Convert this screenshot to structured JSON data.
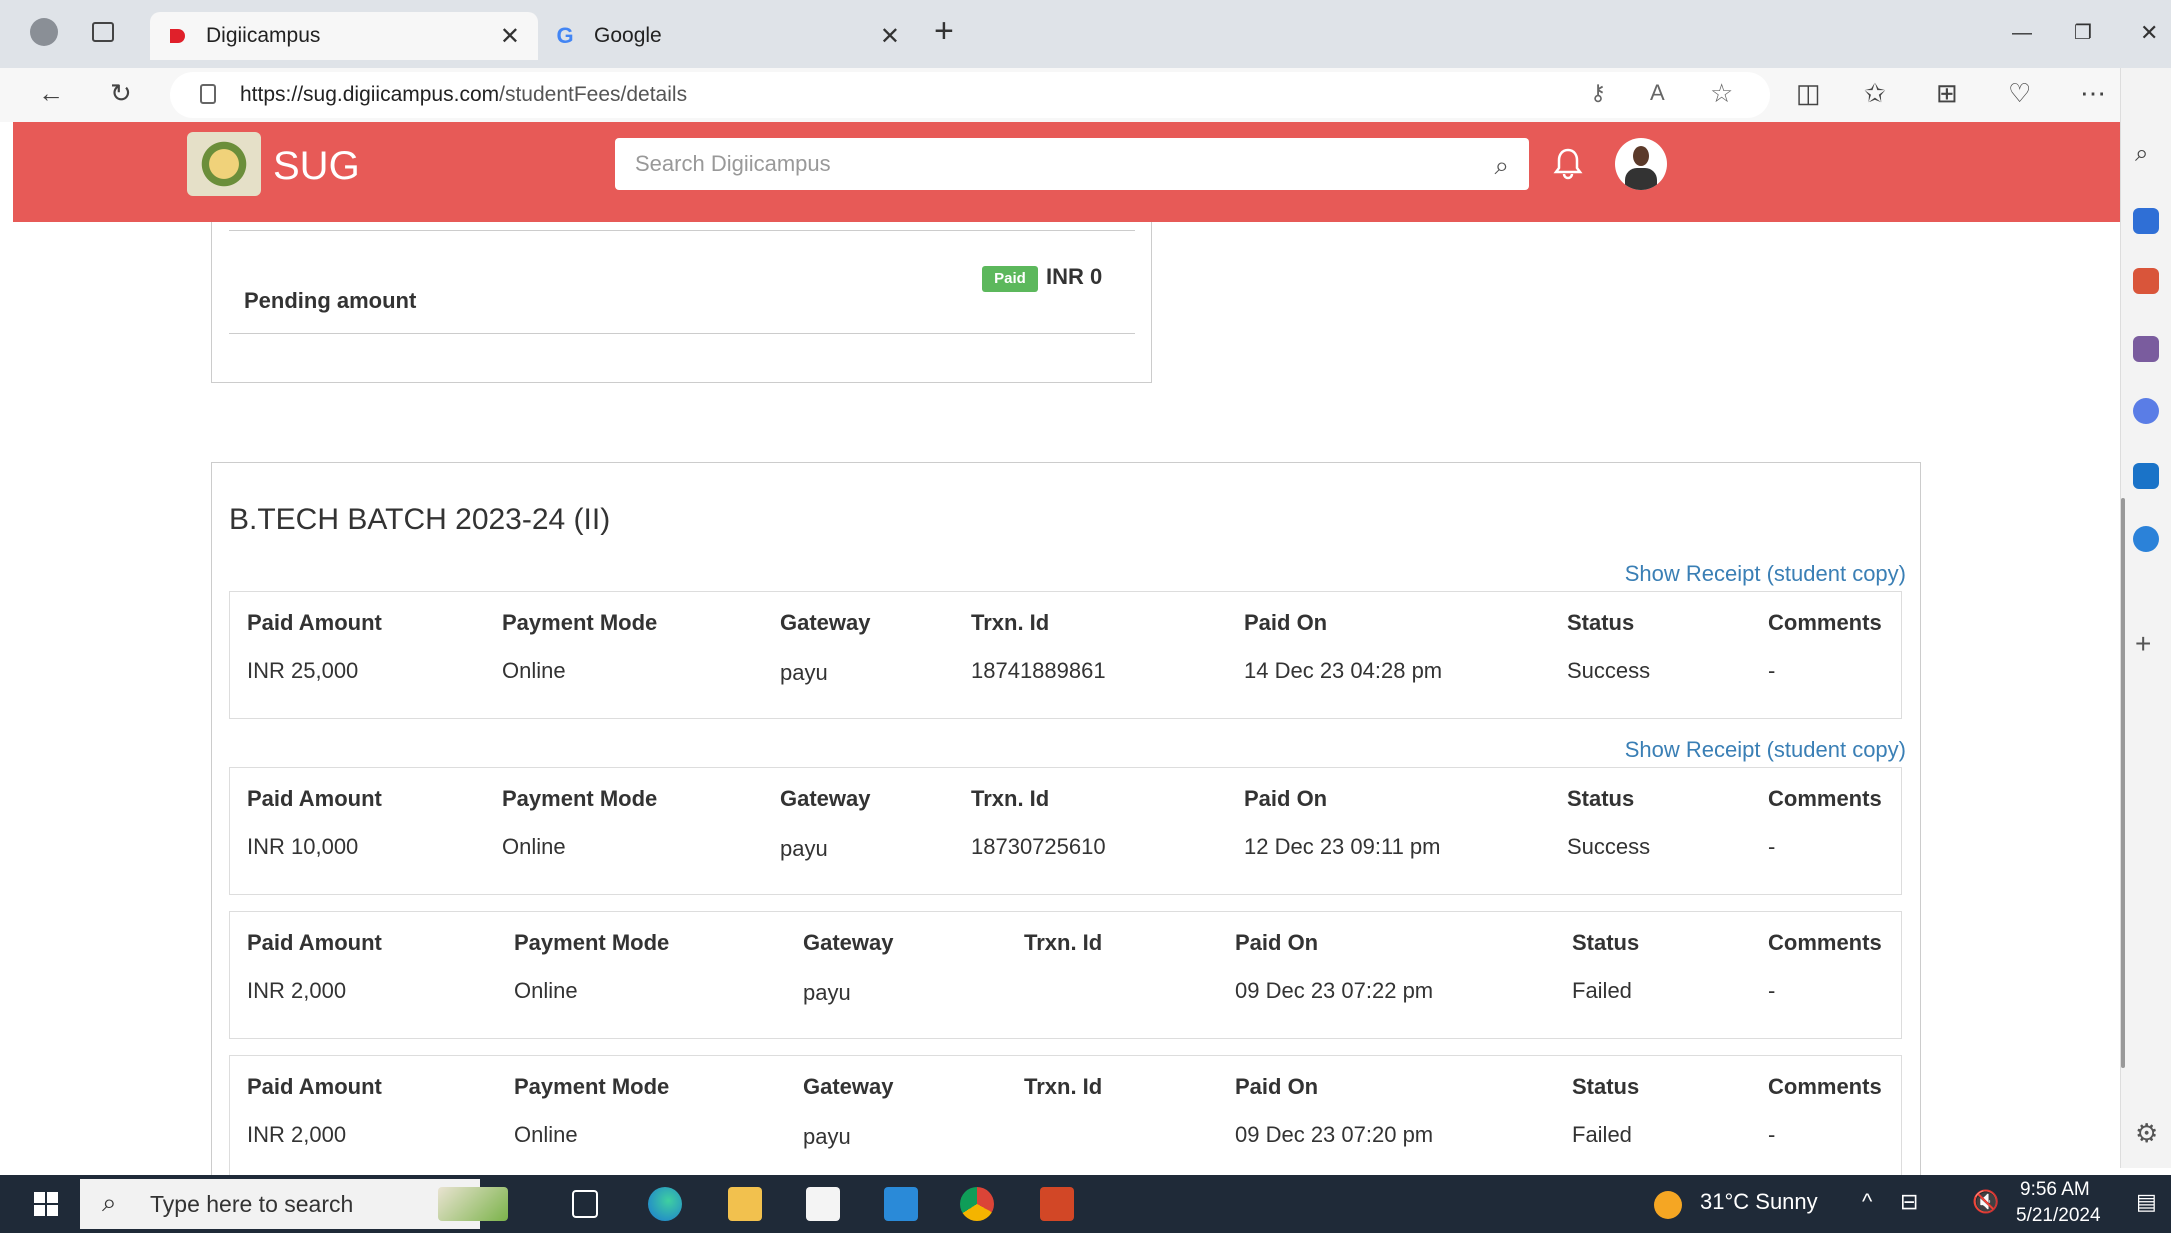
{
  "browser": {
    "tabs": [
      {
        "label": "Digiicampus",
        "active": true
      },
      {
        "label": "Google",
        "active": false
      }
    ],
    "new_tab": "+",
    "url_host": "https://sug.digiicampus.com",
    "url_path": "/studentFees/details",
    "window_controls": {
      "minimize": "—",
      "restore": "❐",
      "close": "✕"
    }
  },
  "header": {
    "brand": "SUG",
    "search_placeholder": "Search Digiicampus"
  },
  "pending": {
    "label": "Pending amount",
    "badge": "Paid",
    "value": "INR 0"
  },
  "batch": {
    "title": "B.TECH BATCH 2023-24 (II)",
    "receipt_link": "Show Receipt (student copy)",
    "columns": [
      "Paid Amount",
      "Payment Mode",
      "Gateway",
      "Trxn. Id",
      "Paid On",
      "Status",
      "Comments"
    ],
    "payments": [
      {
        "amount": "INR 25,000",
        "mode": "Online",
        "gateway": "payu",
        "trxn": "18741889861",
        "paid_on": "14 Dec 23 04:28 pm",
        "status": "Success",
        "comments": "-"
      },
      {
        "amount": "INR 10,000",
        "mode": "Online",
        "gateway": "payu",
        "trxn": "18730725610",
        "paid_on": "12 Dec 23 09:11 pm",
        "status": "Success",
        "comments": "-"
      },
      {
        "amount": "INR 2,000",
        "mode": "Online",
        "gateway": "payu",
        "trxn": "",
        "paid_on": "09 Dec 23 07:22 pm",
        "status": "Failed",
        "comments": "-"
      },
      {
        "amount": "INR 2,000",
        "mode": "Online",
        "gateway": "payu",
        "trxn": "",
        "paid_on": "09 Dec 23 07:20 pm",
        "status": "Failed",
        "comments": "-"
      }
    ]
  },
  "taskbar": {
    "search_placeholder": "Type here to search",
    "weather": "31°C  Sunny",
    "time": "9:56 AM",
    "date": "5/21/2024"
  },
  "colors": {
    "header": "#e75a57",
    "link": "#3a7fb5",
    "badge": "#5cb85c"
  }
}
